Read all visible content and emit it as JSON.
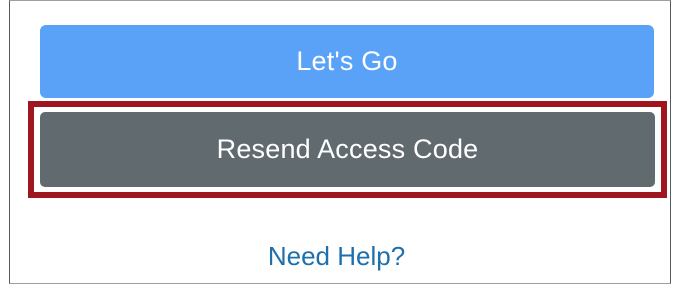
{
  "actions": {
    "primary_label": "Let's Go",
    "secondary_label": "Resend Access Code",
    "help_link_label": "Need Help?"
  },
  "colors": {
    "primary_button": "#5aa2f8",
    "secondary_button": "#606a6f",
    "highlight_outline": "#a01620",
    "link": "#1d6fae"
  }
}
